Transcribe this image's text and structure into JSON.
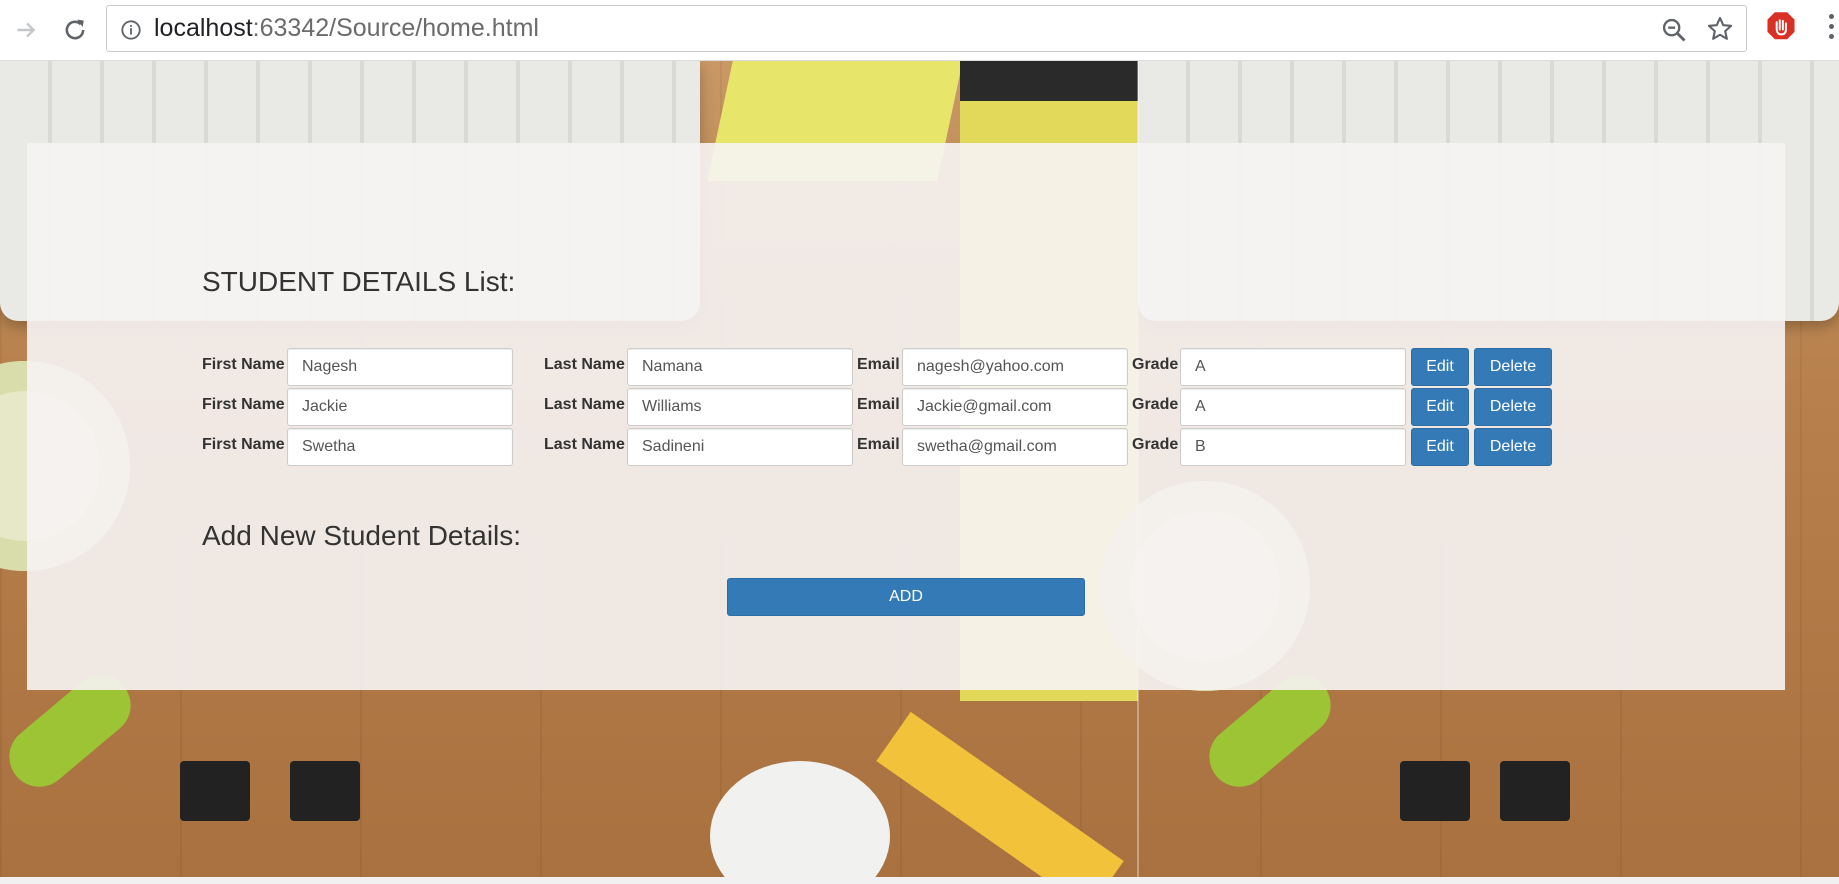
{
  "browser": {
    "url_host": "localhost",
    "url_rest": ":63342/Source/home.html"
  },
  "page": {
    "list_heading": "STUDENT DETAILS List:",
    "add_heading": "Add New Student Details:",
    "add_button_label": "ADD"
  },
  "field_labels": {
    "first_name": "First Name",
    "last_name": "Last Name",
    "email": "Email",
    "grade": "Grade"
  },
  "row_buttons": {
    "edit": "Edit",
    "delete": "Delete"
  },
  "students": [
    {
      "first_name": "Nagesh",
      "last_name": "Namana",
      "email": "nagesh@yahoo.com",
      "grade": "A"
    },
    {
      "first_name": "Jackie",
      "last_name": "Williams",
      "email": "Jackie@gmail.com",
      "grade": "A"
    },
    {
      "first_name": "Swetha",
      "last_name": "Sadineni",
      "email": "swetha@gmail.com",
      "grade": "B"
    }
  ],
  "colors": {
    "primary_button": "#337ab7",
    "panel_overlay": "#f6f3f3",
    "extension_icon": "#d93025"
  },
  "icons": [
    "forward-arrow-icon",
    "reload-icon",
    "info-icon",
    "zoom-icon",
    "star-icon",
    "adblock-icon",
    "menu-dots-icon"
  ]
}
